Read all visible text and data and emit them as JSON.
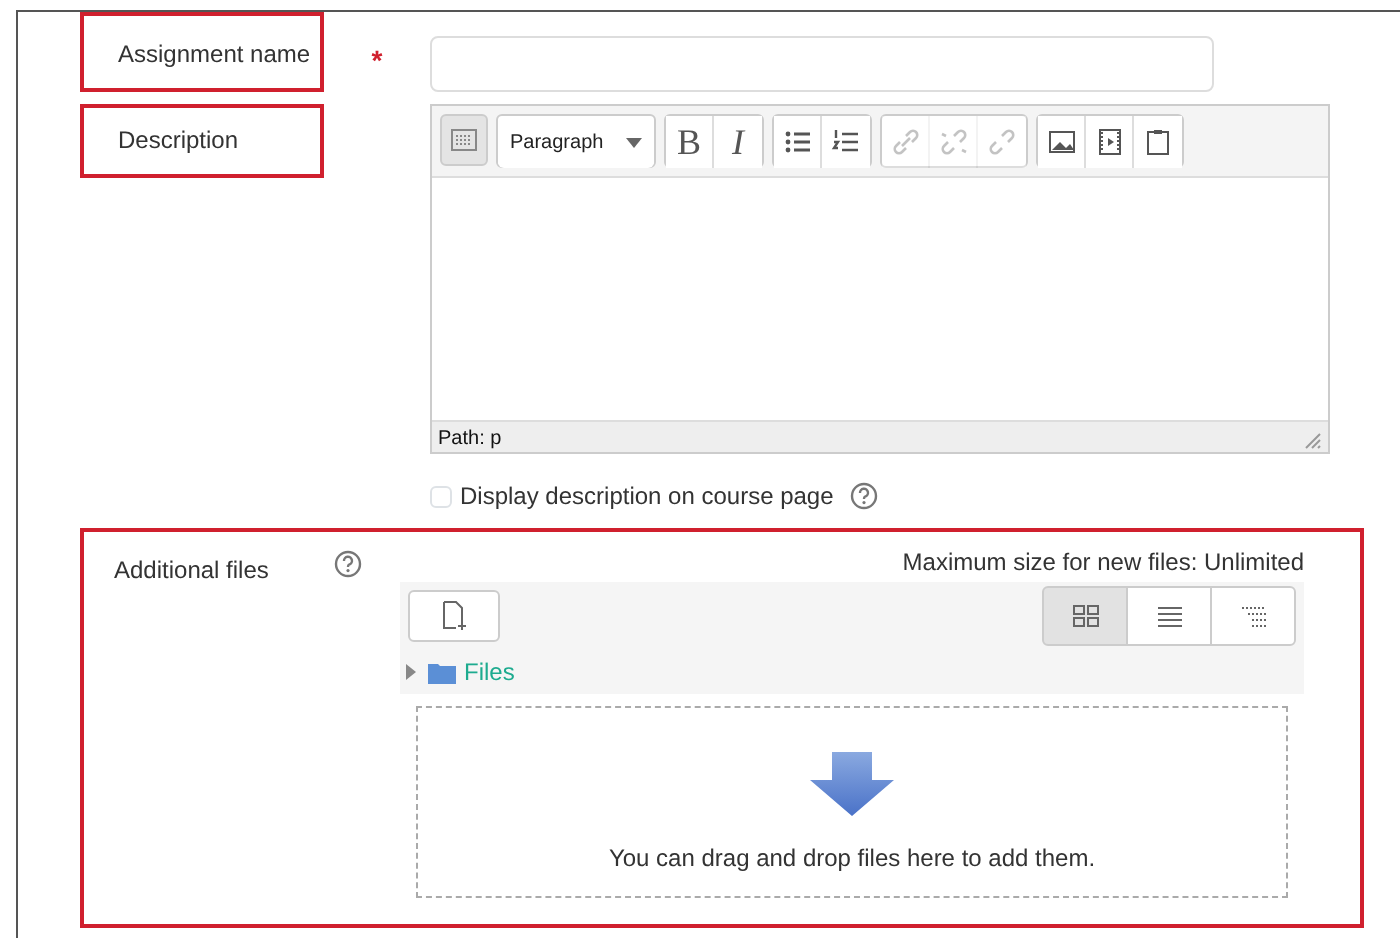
{
  "assignment_name": {
    "label": "Assignment name",
    "highlighted": true,
    "required_mark": "*"
  },
  "description": {
    "label": "Description",
    "highlighted": true,
    "toolbar": [
      {
        "kind": "toggle",
        "pressed": true,
        "disabled": false
      },
      {
        "kind": "dropdown",
        "label": "Paragraph",
        "pressed": false,
        "disabled": false
      },
      {
        "kind": "bold",
        "label": "B",
        "pressed": false,
        "disabled": false
      },
      {
        "kind": "italic",
        "label": "I",
        "pressed": false,
        "disabled": false
      },
      {
        "kind": "bullets",
        "pressed": false,
        "disabled": false
      },
      {
        "kind": "numbers",
        "pressed": false,
        "disabled": false
      },
      {
        "kind": "link",
        "pressed": false,
        "disabled": true
      },
      {
        "kind": "unlink",
        "pressed": false,
        "disabled": true
      },
      {
        "kind": "anchor",
        "pressed": false,
        "disabled": true
      },
      {
        "kind": "image",
        "pressed": false,
        "disabled": false
      },
      {
        "kind": "media",
        "pressed": false,
        "disabled": false
      },
      {
        "kind": "paste",
        "pressed": false,
        "disabled": false
      }
    ],
    "path": "Path: p"
  },
  "display_on_course": {
    "label": "Display description on course page",
    "checked": false
  },
  "additional_files": {
    "label": "Additional files",
    "highlighted": true,
    "max_size": "Maximum size for new files: Unlimited",
    "views": [
      {
        "kind": "icons",
        "selected": true
      },
      {
        "kind": "list",
        "selected": false
      },
      {
        "kind": "tree",
        "selected": false
      }
    ],
    "folder": {
      "label": "Files",
      "expanded": false
    },
    "drop_hint": "You can drag and drop files here to add them."
  }
}
